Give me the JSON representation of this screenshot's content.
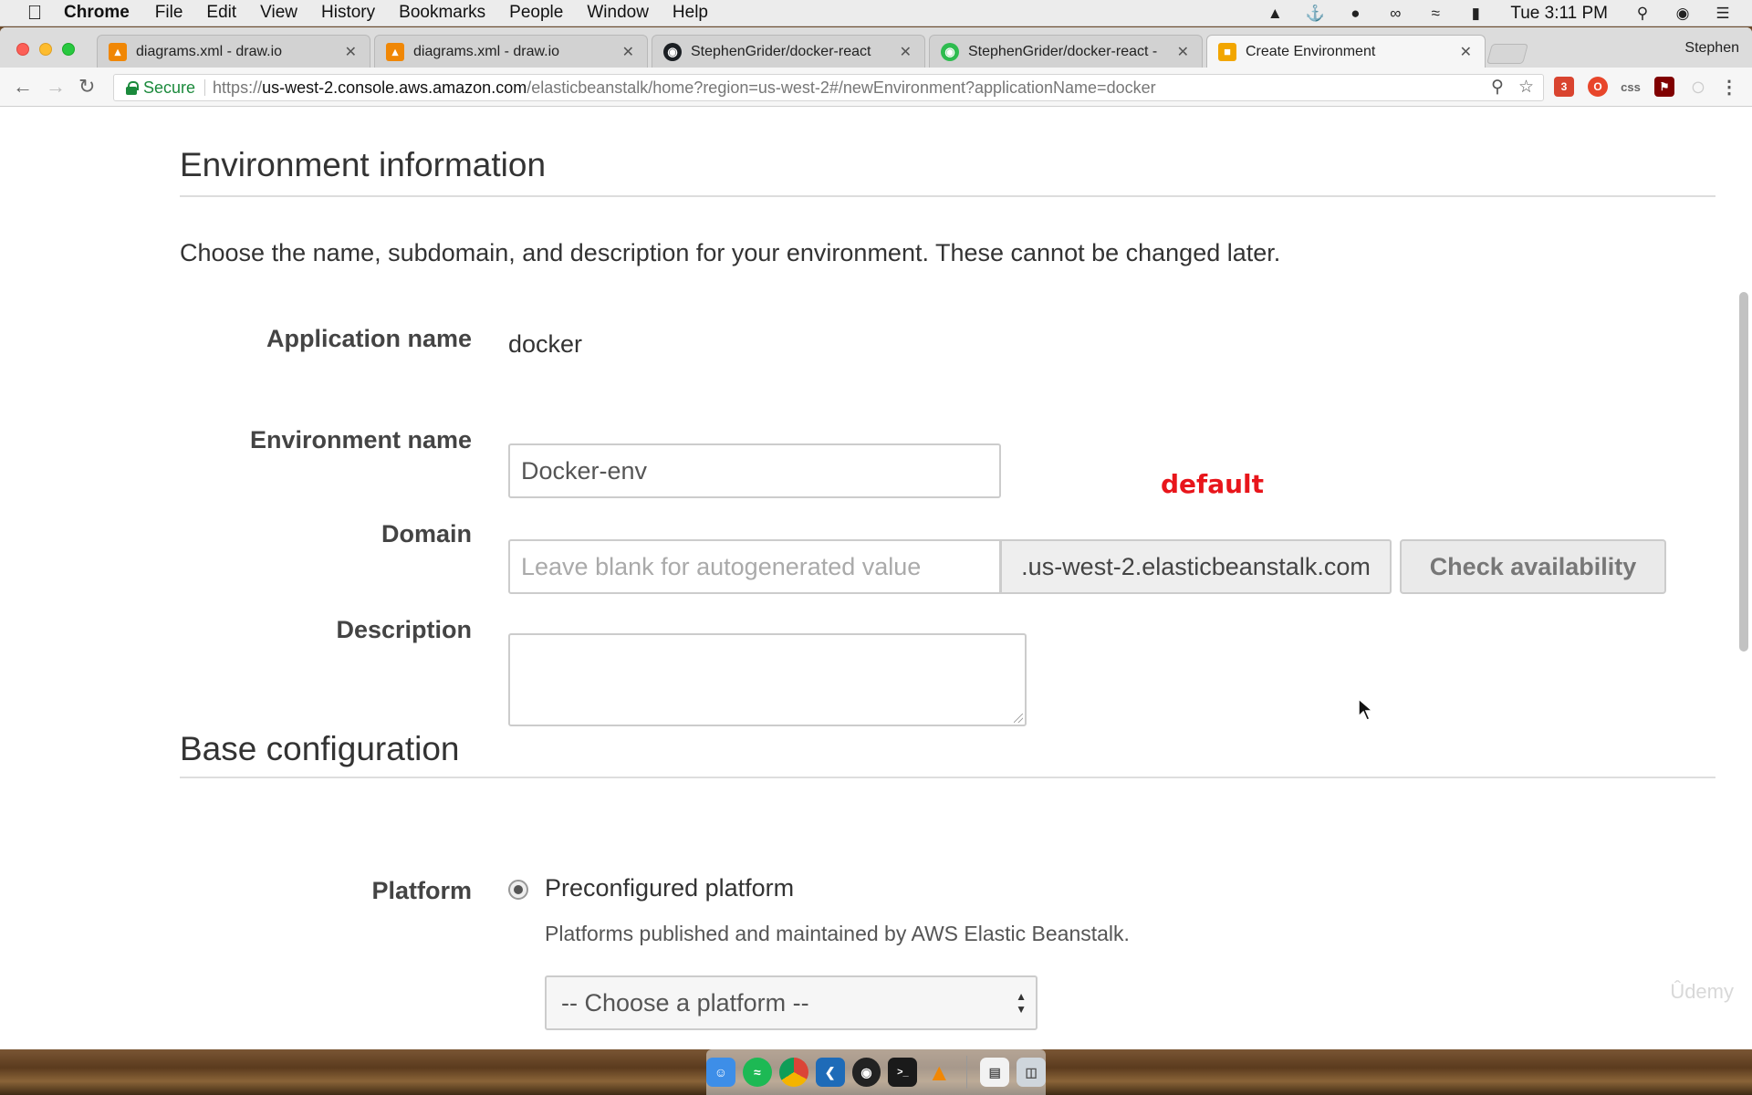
{
  "menubar": {
    "app": "Chrome",
    "items": [
      "File",
      "Edit",
      "View",
      "History",
      "Bookmarks",
      "People",
      "Window",
      "Help"
    ],
    "clock": "Tue 3:11 PM"
  },
  "tabs": [
    {
      "title": "diagrams.xml - draw.io",
      "icon": "drawio-icon"
    },
    {
      "title": "diagrams.xml - draw.io",
      "icon": "drawio-icon"
    },
    {
      "title": "StephenGrider/docker-react",
      "icon": "github-icon"
    },
    {
      "title": "StephenGrider/docker-react -",
      "icon": "github-icon"
    },
    {
      "title": "Create Environment",
      "icon": "aws-icon"
    }
  ],
  "profile": "Stephen",
  "omnibox": {
    "secure_label": "Secure",
    "url_scheme": "https://",
    "url_host": "us-west-2.console.aws.amazon.com",
    "url_path": "/elasticbeanstalk/home?region=us-west-2#/newEnvironment?applicationName=docker"
  },
  "extensions": {
    "badge_count": "3",
    "css_label": "css"
  },
  "env_info": {
    "title": "Environment information",
    "description": "Choose the name, subdomain, and description for your environment. These cannot be changed later.",
    "app_name_label": "Application name",
    "app_name_value": "docker",
    "env_name_label": "Environment name",
    "env_name_value": "Docker-env",
    "domain_label": "Domain",
    "domain_placeholder": "Leave blank for autogenerated value",
    "domain_suffix": ".us-west-2.elasticbeanstalk.com",
    "check_button": "Check availability",
    "description_label": "Description",
    "annotation": "default"
  },
  "base_config": {
    "title": "Base configuration",
    "platform_label": "Platform",
    "platform_option": "Preconfigured platform",
    "platform_help": "Platforms published and maintained by AWS Elastic Beanstalk.",
    "platform_select": "-- Choose a platform --"
  },
  "watermark": "Ûdemy",
  "colors": {
    "accent_red": "#e8151b",
    "secure_green": "#1b8a3c"
  }
}
